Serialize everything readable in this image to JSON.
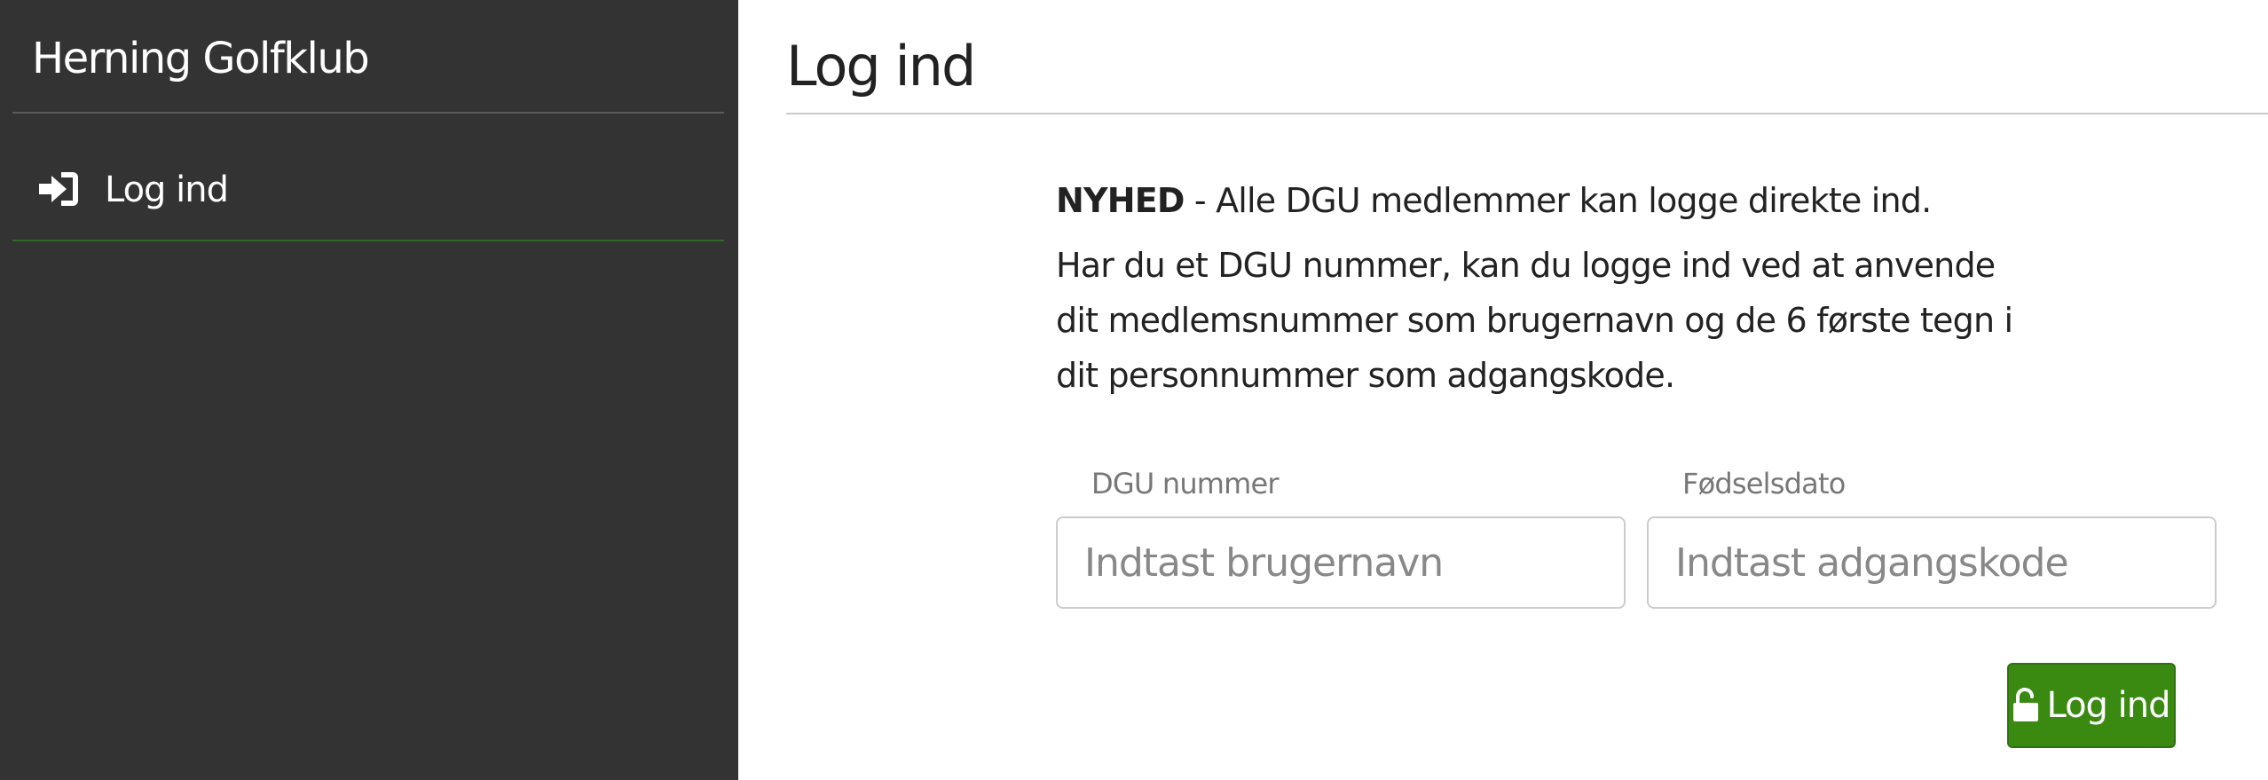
{
  "sidebar": {
    "brand": "Herning Golfklub",
    "items": [
      {
        "label": "Log ind",
        "icon": "sign-in-icon"
      }
    ]
  },
  "main": {
    "title": "Log ind",
    "news_strong": "NYHED",
    "news_text": " - Alle DGU medlemmer kan logge direkte ind.",
    "info": "Har du et DGU nummer, kan du logge ind ved at anvende dit medlemsnummer som brugernavn og de 6 første tegn i dit personnummer som adgangskode.",
    "username": {
      "label": "DGU nummer",
      "placeholder": "Indtast brugernavn",
      "value": ""
    },
    "password": {
      "label": "Fødselsdato",
      "placeholder": "Indtast adgangskode",
      "value": ""
    },
    "login_button": {
      "label": "Log ind",
      "icon": "unlock-icon"
    }
  },
  "colors": {
    "sidebar_bg": "#333333",
    "accent_green": "#3a8a12",
    "text": "#222222"
  }
}
